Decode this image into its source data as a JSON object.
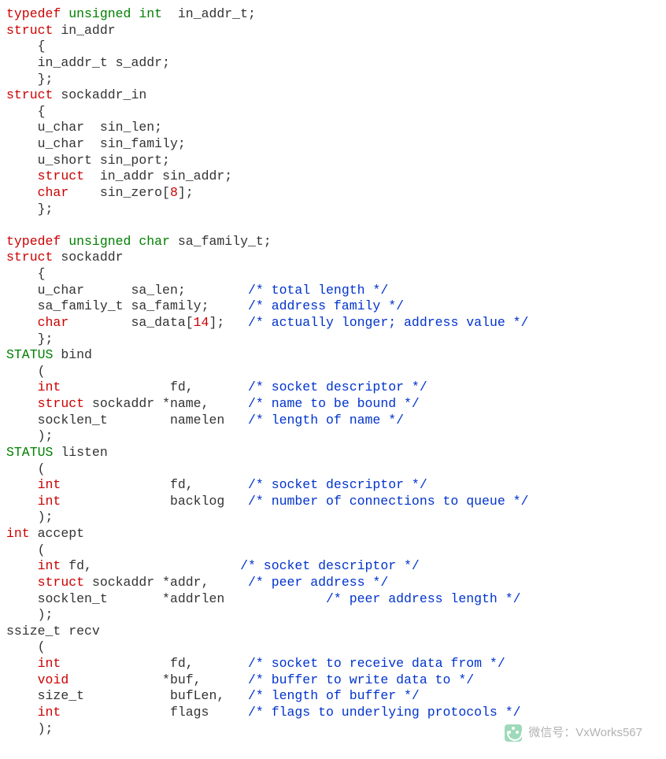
{
  "tokens": {
    "t_typedef": "typedef",
    "t_unsigned": "unsigned",
    "t_int": "int",
    "t_char": "char",
    "t_void": "void",
    "t_struct": "struct",
    "t_in_addr_t": "in_addr_t",
    "t_sa_family_t": "sa_family_t",
    "t_u_char": "u_char",
    "t_u_short": "u_short",
    "t_socklen_t": "socklen_t",
    "t_size_t": "size_t",
    "t_ssize_t": "ssize_t",
    "t_STATUS": "STATUS",
    "id_in_addr": "in_addr",
    "id_s_addr": "s_addr",
    "id_sockaddr_in": "sockaddr_in",
    "id_sin_len": "sin_len",
    "id_sin_family": "sin_family",
    "id_sin_port": "sin_port",
    "id_sin_addr": "sin_addr",
    "id_sin_zero": "sin_zero",
    "id_sockaddr": "sockaddr",
    "id_sa_len": "sa_len",
    "id_sa_family": "sa_family",
    "id_sa_data": "sa_data",
    "id_bind": "bind",
    "id_listen": "listen",
    "id_accept": "accept",
    "id_recv": "recv",
    "id_fd": "fd",
    "id_name": "name",
    "id_namelen": "namelen",
    "id_backlog": "backlog",
    "id_addr": "addr",
    "id_addrlen": "addrlen",
    "id_buf": "buf",
    "id_bufLen": "bufLen",
    "id_flags": "flags",
    "n_8": "8",
    "n_14": "14",
    "cm_total_length": "/* total length */",
    "cm_address_family": "/* address family */",
    "cm_actually_longer": "/* actually longer; address value */",
    "cm_socket_descriptor": "/* socket descriptor */",
    "cm_name_to_be_bound": "/* name to be bound */",
    "cm_length_of_name": "/* length of name */",
    "cm_num_connections": "/* number of connections to queue */",
    "cm_peer_address": "/* peer address */",
    "cm_peer_addr_len": "/* peer address length */",
    "cm_socket_recv": "/* socket to receive data from */",
    "cm_buffer_write": "/* buffer to write data to */",
    "cm_length_buffer": "/* length of buffer */",
    "cm_flags_protocols": "/* flags to underlying protocols */"
  },
  "punct": {
    "semi": ";",
    "lbrace": "{",
    "rbrace_semi": "};",
    "lparen": "(",
    "rparen_semi": ");",
    "comma": ",",
    "star": "*",
    "lbracket": "[",
    "rbracket": "]"
  },
  "watermark": {
    "label": "微信号：VxWorks567"
  }
}
